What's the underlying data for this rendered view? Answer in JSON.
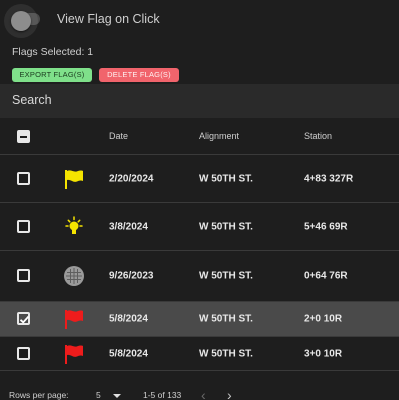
{
  "toggle": {
    "label": "View Flag on Click",
    "on": false
  },
  "flags_selected": "Flags Selected: 1",
  "buttons": {
    "export": "EXPORT FLAG(S)",
    "delete": "DELETE FLAG(S)",
    "export_color": "#7fe08a",
    "delete_color": "#f1646c"
  },
  "search": {
    "placeholder": "Search"
  },
  "table": {
    "headers": {
      "date": "Date",
      "alignment": "Alignment",
      "station": "Station"
    },
    "rows": [
      {
        "icon": "yellow-flag-icon",
        "date": "2/20/2024",
        "alignment": "W 50TH ST.",
        "station": "4+83 327R",
        "selected": false
      },
      {
        "icon": "lightbulb-icon",
        "date": "3/8/2024",
        "alignment": "W 50TH ST.",
        "station": "5+46 69R",
        "selected": false
      },
      {
        "icon": "grid-ball-icon",
        "date": "9/26/2023",
        "alignment": "W 50TH ST.",
        "station": "0+64 76R",
        "selected": false
      },
      {
        "icon": "red-flag-icon",
        "date": "5/8/2024",
        "alignment": "W 50TH ST.",
        "station": "2+0 10R",
        "selected": true
      },
      {
        "icon": "red-flag-icon",
        "date": "5/8/2024",
        "alignment": "W 50TH ST.",
        "station": "3+0 10R",
        "selected": false
      }
    ]
  },
  "pagination": {
    "rows_per_page_label": "Rows per page:",
    "rows_per_page": "5",
    "range": "1-5 of 133",
    "prev": "‹",
    "next": "›"
  }
}
